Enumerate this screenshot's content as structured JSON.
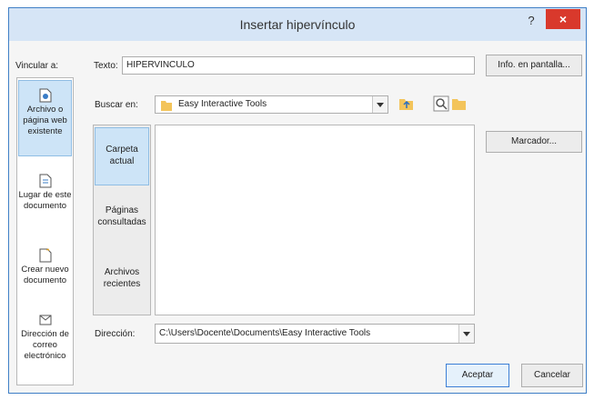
{
  "dialog": {
    "title": "Insertar hipervínculo",
    "help": "?",
    "close": "×"
  },
  "link_to": {
    "label": "Vincular a:",
    "items": [
      {
        "line1": "Archivo o",
        "line2": "página web",
        "line3": "existente",
        "selected": true
      },
      {
        "line1": "Lugar de este",
        "line2": "documento",
        "line3": ""
      },
      {
        "line1": "Crear nuevo",
        "line2": "documento",
        "line3": ""
      },
      {
        "line1": "Dirección de",
        "line2": "correo",
        "line3": "electrónico"
      }
    ]
  },
  "text": {
    "label": "Texto:",
    "value": "HIPERVINCULO",
    "screentip_button": "Info. en pantalla..."
  },
  "look_in": {
    "label": "Buscar en:",
    "value": "Easy Interactive Tools"
  },
  "nav": {
    "items": [
      {
        "line1": "Carpeta",
        "line2": "actual",
        "selected": true
      },
      {
        "line1": "Páginas",
        "line2": "consultadas"
      },
      {
        "line1": "Archivos",
        "line2": "recientes"
      }
    ]
  },
  "bookmark_button": "Marcador...",
  "address": {
    "label": "Dirección:",
    "value": "C:\\Users\\Docente\\Documents\\Easy Interactive Tools"
  },
  "buttons": {
    "ok": "Aceptar",
    "cancel": "Cancelar"
  },
  "colors": {
    "titlebar": "#d6e5f6",
    "close": "#d9392c",
    "selection": "#cde4f7",
    "folder": "#f3c45a"
  }
}
